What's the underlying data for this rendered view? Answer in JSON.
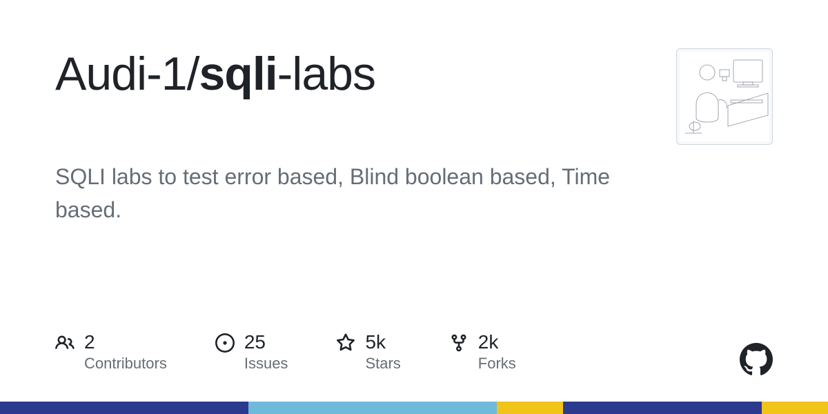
{
  "repo": {
    "owner": "Audi-1",
    "separator": "/",
    "name_bold": "sqli",
    "name_rest": "-labs"
  },
  "description": "SQLI labs to test error based, Blind boolean based, Time based.",
  "stats": {
    "contributors": {
      "value": "2",
      "label": "Contributors"
    },
    "issues": {
      "value": "25",
      "label": "Issues"
    },
    "stars": {
      "value": "5k",
      "label": "Stars"
    },
    "forks": {
      "value": "2k",
      "label": "Forks"
    }
  }
}
